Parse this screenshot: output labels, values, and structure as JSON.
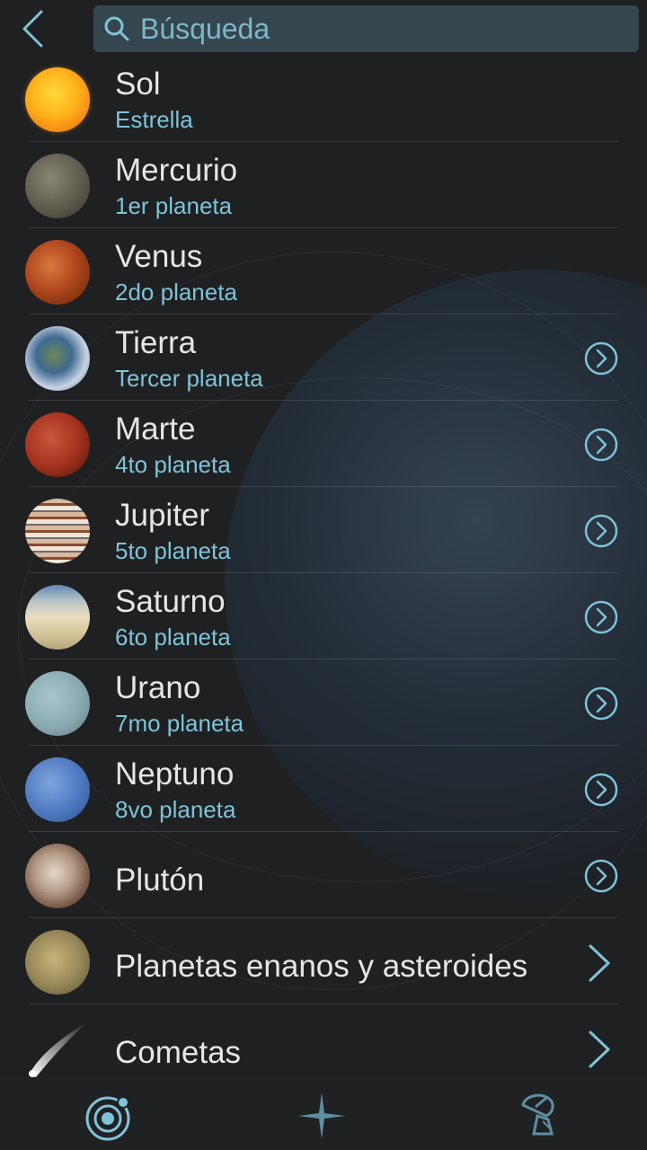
{
  "search": {
    "placeholder": "Búsqueda"
  },
  "list": {
    "items": [
      {
        "key": "sol",
        "title": "Sol",
        "subtitle": "Estrella",
        "action": "none"
      },
      {
        "key": "mercurio",
        "title": "Mercurio",
        "subtitle": "1er planeta",
        "action": "none"
      },
      {
        "key": "venus",
        "title": "Venus",
        "subtitle": "2do planeta",
        "action": "none"
      },
      {
        "key": "tierra",
        "title": "Tierra",
        "subtitle": "Tercer planeta",
        "action": "circle-chevron-right-icon"
      },
      {
        "key": "marte",
        "title": "Marte",
        "subtitle": "4to planeta",
        "action": "circle-chevron-right-icon"
      },
      {
        "key": "jupiter",
        "title": "Jupiter",
        "subtitle": "5to planeta",
        "action": "circle-chevron-right-icon"
      },
      {
        "key": "saturno",
        "title": "Saturno",
        "subtitle": "6to planeta",
        "action": "circle-chevron-right-icon"
      },
      {
        "key": "urano",
        "title": "Urano",
        "subtitle": "7mo planeta",
        "action": "circle-chevron-right-icon"
      },
      {
        "key": "neptuno",
        "title": "Neptuno",
        "subtitle": "8vo planeta",
        "action": "circle-chevron-right-icon"
      },
      {
        "key": "pluton",
        "title": "Plutón",
        "subtitle": "",
        "action": "circle-chevron-right-icon"
      },
      {
        "key": "enanos",
        "title": "Planetas enanos y asteroides",
        "subtitle": "",
        "action": "chevron-right-icon"
      },
      {
        "key": "cometas",
        "title": "Cometas",
        "subtitle": "",
        "action": "chevron-right-icon"
      }
    ]
  },
  "tabbar": {
    "tabs": [
      {
        "icon": "solar-system-icon",
        "active": true
      },
      {
        "icon": "star-icon",
        "active": false
      },
      {
        "icon": "satellite-dish-icon",
        "active": false
      }
    ]
  },
  "colors": {
    "background": "#1f2022",
    "accent": "#7fc3d8",
    "title_text": "#e6e6e6",
    "search_bg": "#34474f"
  }
}
